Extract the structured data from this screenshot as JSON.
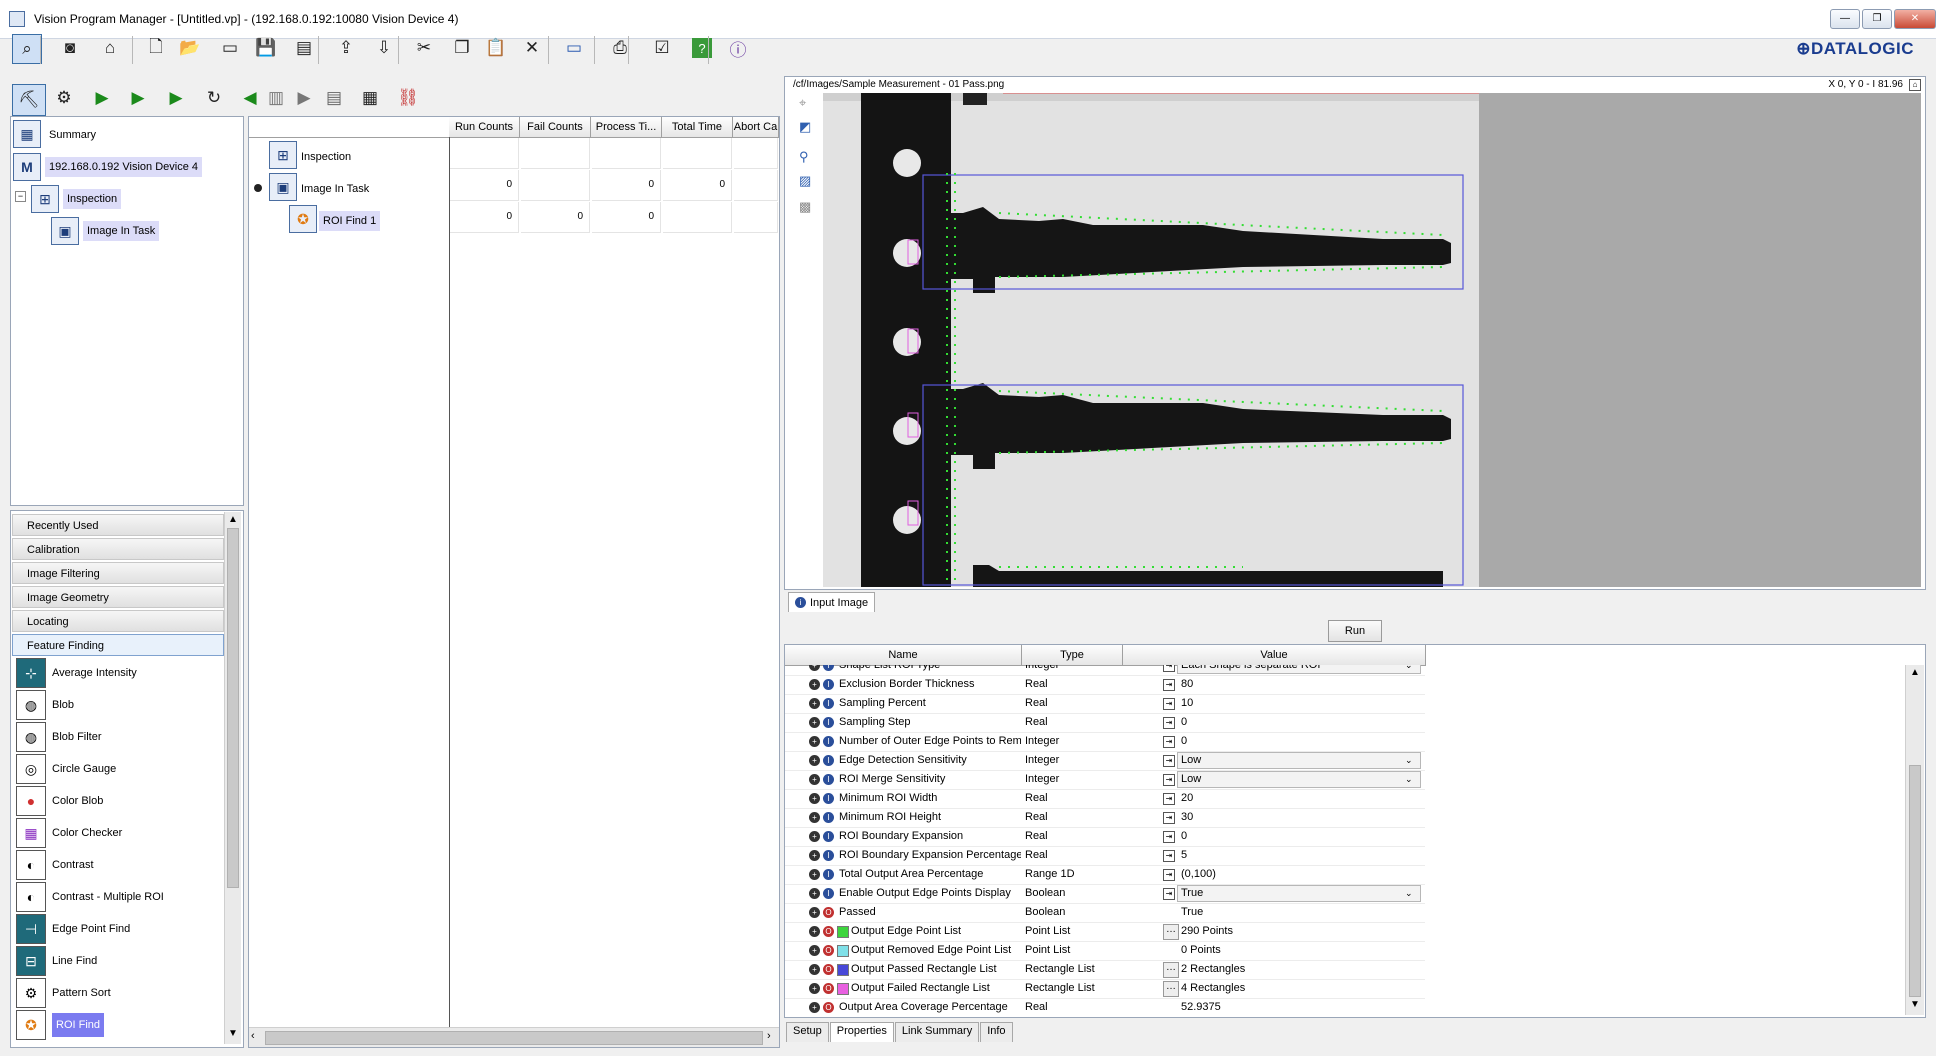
{
  "window": {
    "title": "Vision Program Manager - [Untitled.vp] - (192.168.0.192:10080 Vision Device 4)"
  },
  "brand": {
    "logo": "⊕DATALOGIC",
    "color": "#1a3c8f"
  },
  "toolbar": {
    "icons": [
      "select-icon",
      "camera-icon",
      "home-icon",
      "new-file-icon",
      "open-icon",
      "folder-icon",
      "save-icon",
      "save-all-icon",
      "export-icon",
      "import-icon",
      "cut-icon",
      "copy-icon",
      "paste-icon",
      "delete-icon",
      "monitor-icon",
      "print-icon",
      "checklist-icon",
      "help-icon",
      "info-icon"
    ]
  },
  "tree": {
    "items": [
      {
        "label": "Summary"
      },
      {
        "label": "192.168.0.192 Vision Device 4"
      },
      {
        "label": "Inspection"
      },
      {
        "label": "Image In Task"
      }
    ]
  },
  "grid": {
    "headers": [
      "Run Counts",
      "Fail Counts",
      "Process Ti...",
      "Total Time",
      "Abort Ca"
    ],
    "rows": [
      {
        "name": "Inspection",
        "values": [
          "",
          "",
          "",
          "",
          ""
        ]
      },
      {
        "name": "Image In Task",
        "values": [
          "0",
          "",
          "0",
          "0",
          ""
        ]
      },
      {
        "name": "ROI Find 1",
        "values": [
          "0",
          "0",
          "0",
          "",
          ""
        ]
      }
    ]
  },
  "categories": [
    "Recently Used",
    "Calibration",
    "Image Filtering",
    "Image Geometry",
    "Locating",
    "Feature Finding"
  ],
  "tools": [
    "Average Intensity",
    "Blob",
    "Blob Filter",
    "Circle Gauge",
    "Color Blob",
    "Color Checker",
    "Contrast",
    "Contrast - Multiple ROI",
    "Edge Point Find",
    "Line Find",
    "Pattern Sort",
    "ROI Find"
  ],
  "image": {
    "path": "/cf/Images/Sample Measurement - 01 Pass.png",
    "coords": "X 0, Y 0 - I 81.96",
    "tab": "Input Image"
  },
  "run_label": "Run",
  "props": {
    "headers": {
      "name": "Name",
      "type": "Type",
      "value": "Value"
    },
    "rows": [
      {
        "name": "Shape List ROI Type",
        "type": "Integer",
        "value": "Each Shape is separate ROI",
        "kind": "in",
        "dropdown": true,
        "partial": true
      },
      {
        "name": "Exclusion Border Thickness",
        "type": "Real",
        "value": "80",
        "kind": "in"
      },
      {
        "name": "Sampling Percent",
        "type": "Real",
        "value": "10",
        "kind": "in"
      },
      {
        "name": "Sampling Step",
        "type": "Real",
        "value": "0",
        "kind": "in"
      },
      {
        "name": "Number of Outer Edge Points to Rem",
        "type": "Integer",
        "value": "0",
        "kind": "in"
      },
      {
        "name": "Edge Detection Sensitivity",
        "type": "Integer",
        "value": "Low",
        "kind": "in",
        "dropdown": true
      },
      {
        "name": "ROI Merge Sensitivity",
        "type": "Integer",
        "value": "Low",
        "kind": "in",
        "dropdown": true
      },
      {
        "name": "Minimum ROI Width",
        "type": "Real",
        "value": "20",
        "kind": "in"
      },
      {
        "name": "Minimum ROI Height",
        "type": "Real",
        "value": "30",
        "kind": "in"
      },
      {
        "name": "ROI Boundary Expansion",
        "type": "Real",
        "value": "0",
        "kind": "in"
      },
      {
        "name": "ROI Boundary Expansion Percentage",
        "type": "Real",
        "value": "5",
        "kind": "in"
      },
      {
        "name": "Total Output Area Percentage",
        "type": "Range 1D",
        "value": "(0,100)",
        "kind": "in"
      },
      {
        "name": "Enable Output Edge Points Display",
        "type": "Boolean",
        "value": "True",
        "kind": "in",
        "dropdown": true
      },
      {
        "name": "Passed",
        "type": "Boolean",
        "value": "True",
        "kind": "out"
      },
      {
        "name": "Output Edge Point List",
        "type": "Point List",
        "value": "290 Points",
        "kind": "out",
        "color": "#3dd43d",
        "ellipsis": true
      },
      {
        "name": "Output Removed Edge Point List",
        "type": "Point List",
        "value": "0 Points",
        "kind": "out",
        "color": "#7fe0e8"
      },
      {
        "name": "Output Passed Rectangle List",
        "type": "Rectangle List",
        "value": "2 Rectangles",
        "kind": "out",
        "color": "#4848d8",
        "ellipsis": true
      },
      {
        "name": "Output Failed Rectangle List",
        "type": "Rectangle List",
        "value": "4 Rectangles",
        "kind": "out",
        "color": "#e860e0",
        "ellipsis": true
      },
      {
        "name": "Output Area Coverage Percentage",
        "type": "Real",
        "value": "52.9375",
        "kind": "out"
      }
    ]
  },
  "bottom_tabs": [
    "Setup",
    "Properties",
    "Link Summary",
    "Info"
  ]
}
